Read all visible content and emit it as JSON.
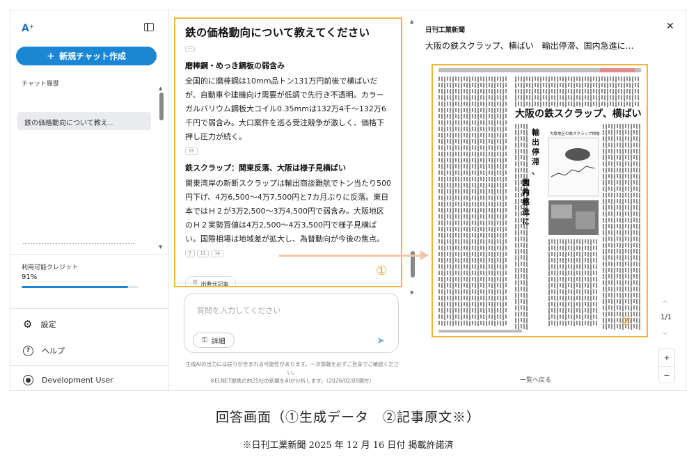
{
  "sidebar": {
    "logo": "A⁺",
    "new_chat_label": "新規チャット作成",
    "history_label": "チャット履歴",
    "history_items": [
      "鉄の価格動向について教え…"
    ],
    "credit_label": "利用可能クレジット",
    "credit_value": "91%",
    "credit_fraction": 0.91,
    "settings_label": "設定",
    "help_label": "ヘルプ",
    "user_name": "Development User"
  },
  "answer": {
    "question": "鉄の価格動向について教えてください",
    "section1_title": "磨棒鋼・めっき鋼板の弱含み",
    "section1_text": "全国的に磨棒鋼は10mm品トン131万円前後で横ばいだが、自動車や建機向け需要が低調で先行き不透明。カラーガルバリウム鋼板大コイル0.35mmは132万4千〜132万6千円で弱含み。大口案件を巡る受注競争が激しく、価格下押し圧力が続く。",
    "section1_cites": [
      "15"
    ],
    "section2_title": "鉄スクラップ：関東反落、大阪は様子見横ばい",
    "section2_text": "関東湾岸の新断スクラップは輸出商談難航でトン当たり500円下げ、4万6,500〜4万7,500円と7カ月ぶりに反落。東日本ではＨ２が3万2,500〜3万4,500円で弱含み。大阪地区のＨ２実勢買値は4万2,500〜4万3,500円で様子見横ばい。国際相場は地域差が拡大し、為替動向が今後の焦点。",
    "section2_cites": [
      "7",
      "13",
      "14"
    ],
    "source_button": "出典元記事",
    "marker": "①"
  },
  "input": {
    "placeholder": "質問を入力してください",
    "detail_label": "詳細",
    "disclaimer_line1": "生成AIの出力には誤りが含まれる可能性があります。一次情報を必ずご自身でご確認ください。",
    "disclaimer_line2": "※ELNET提携の約25社の新聞をAIが分析します。（2026/02/09現在）"
  },
  "article": {
    "paper_name": "日刊工業新聞",
    "title": "大阪の鉄スクラップ、横ばい　輸出停滞、国内急進に…",
    "headline": "大阪の鉄スクラップ、横ばい",
    "subheadline": "輸出停滞、国内急進に大井感",
    "chart_caption": "大阪地区の鉄スクラップ相場",
    "page_indicator": "1/1",
    "back_label": "一覧へ戻る",
    "marker": "②"
  },
  "captions": {
    "main": "回答画面（①生成データ　②記事原文※）",
    "sub": "※日刊工業新聞 2025 年 12 月 16 日付 掲載許諾済"
  }
}
